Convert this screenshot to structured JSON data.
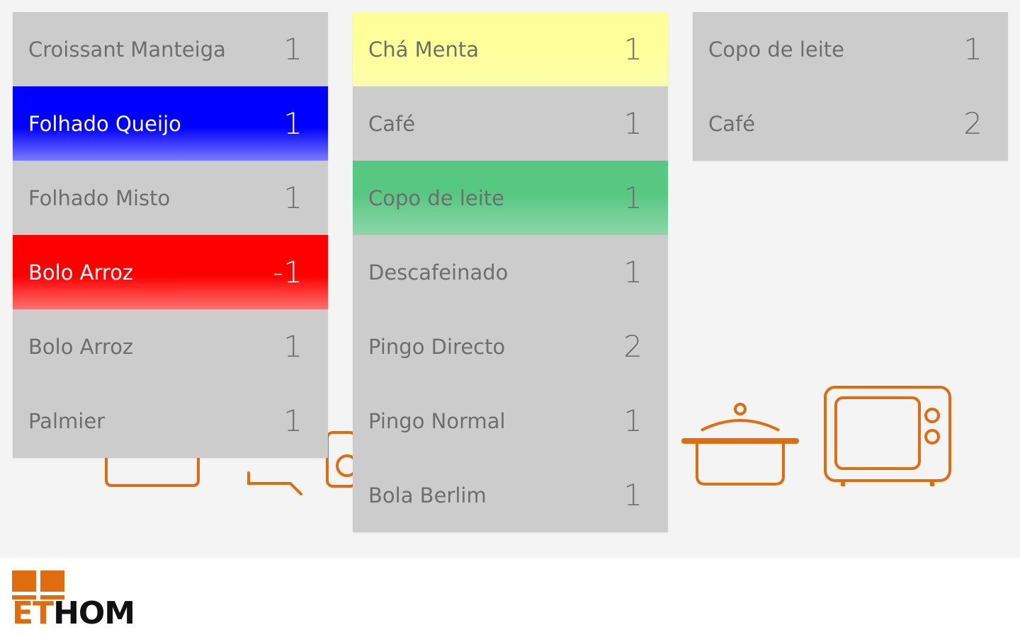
{
  "columns": [
    {
      "items": [
        {
          "name": "Croissant Manteiga",
          "qty": "1",
          "color": "#cccccc"
        },
        {
          "name": "Folhado Queijo",
          "qty": "1",
          "color": "#0000ff"
        },
        {
          "name": "Folhado Misto",
          "qty": "1",
          "color": "#cccccc"
        },
        {
          "name": "Bolo Arroz",
          "qty": "-1",
          "color": "#ff0000"
        },
        {
          "name": "Bolo Arroz",
          "qty": "1",
          "color": "#cccccc"
        },
        {
          "name": "Palmier",
          "qty": "1",
          "color": "#cccccc"
        }
      ]
    },
    {
      "items": [
        {
          "name": "Chá Menta",
          "qty": "1",
          "color": "#ffff99"
        },
        {
          "name": "Café",
          "qty": "1",
          "color": "#cccccc"
        },
        {
          "name": "Copo de leite",
          "qty": "1",
          "color": "#57c882"
        },
        {
          "name": "Descafeinado",
          "qty": "1",
          "color": "#cccccc"
        },
        {
          "name": "Pingo Directo",
          "qty": "2",
          "color": "#cccccc"
        },
        {
          "name": "Pingo Normal",
          "qty": "1",
          "color": "#cccccc"
        },
        {
          "name": "Bola Berlim",
          "qty": "1",
          "color": "#cccccc"
        }
      ]
    },
    {
      "items": [
        {
          "name": "Copo de leite",
          "qty": "1",
          "color": "#cccccc"
        },
        {
          "name": "Café",
          "qty": "2",
          "color": "#cccccc"
        }
      ]
    }
  ],
  "background_icons": [
    "pot-icon",
    "microwave-icon",
    "scale-icon",
    "baking-tray-icon"
  ],
  "colors": {
    "accent": "#e06c10",
    "background": "#f4f4f4",
    "item_default": "#cccccc",
    "text_default": "#6e6e6e"
  },
  "brand": {
    "logo_text": "ETHOM"
  }
}
